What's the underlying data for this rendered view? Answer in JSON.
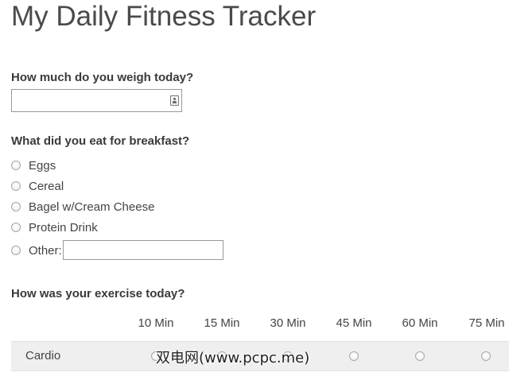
{
  "form": {
    "title": "My Daily Fitness Tracker",
    "weight_question": "How much do you weigh today?",
    "weight_value": "",
    "breakfast_question": "What did you eat for breakfast?",
    "breakfast_options": [
      "Eggs",
      "Cereal",
      "Bagel w/Cream Cheese",
      "Protein Drink"
    ],
    "other_label": "Other:",
    "other_value": "",
    "exercise_question": "How was your exercise today?",
    "exercise_columns": [
      "10 Min",
      "15 Min",
      "30 Min",
      "45 Min",
      "60 Min",
      "75 Min"
    ],
    "exercise_rows": [
      "Cardio"
    ]
  },
  "watermark": "双电网(www.pcpc.me)",
  "icons": {
    "weight_field_icon": "contact-card-icon"
  },
  "colors": {
    "title": "#4a4a4a",
    "row_background": "#efefef",
    "border": "#9a9a9a"
  }
}
